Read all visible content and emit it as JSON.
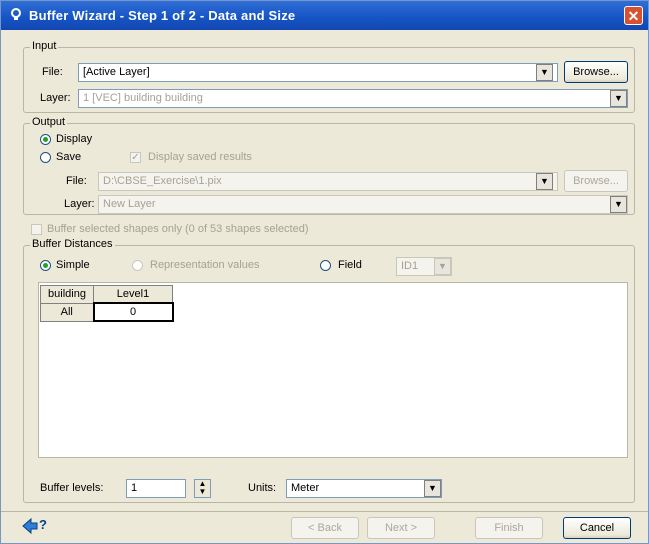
{
  "window": {
    "title": "Buffer Wizard - Step 1 of 2 - Data and Size",
    "close_glyph": "✕"
  },
  "input_group": {
    "legend": "Input",
    "file_label": "File:",
    "file_value": "[Active Layer]",
    "browse_label": "Browse...",
    "layer_label": "Layer:",
    "layer_value": "1 [VEC] building building"
  },
  "output_group": {
    "legend": "Output",
    "display_label": "Display",
    "save_label": "Save",
    "display_saved_label": "Display saved results",
    "file_label": "File:",
    "file_value": "D:\\CBSE_Exercise\\1.pix",
    "browse_label": "Browse...",
    "layer_label": "Layer:",
    "layer_value": "New Layer"
  },
  "buffer_selected_label": "Buffer selected shapes only (0 of 53 shapes selected)",
  "distances_group": {
    "legend": "Buffer Distances",
    "simple_label": "Simple",
    "representation_label": "Representation values",
    "field_label": "Field",
    "field_value": "ID1",
    "table": {
      "headers": [
        "building",
        "Level1"
      ],
      "rows": [
        {
          "label": "All",
          "value": "0"
        }
      ]
    },
    "buffer_levels_label": "Buffer levels:",
    "buffer_levels_value": "1",
    "units_label": "Units:",
    "units_value": "Meter"
  },
  "footer": {
    "help_glyph": "?",
    "back_label": "< Back",
    "next_label": "Next >",
    "finish_label": "Finish",
    "cancel_label": "Cancel"
  },
  "colors": {
    "titlebar": "#1553c4",
    "face": "#ece9d8",
    "close": "#d8502f"
  },
  "icons": [
    "app-icon",
    "close-icon",
    "dropdown-arrow-icon",
    "spin-arrows-icon",
    "help-icon"
  ]
}
